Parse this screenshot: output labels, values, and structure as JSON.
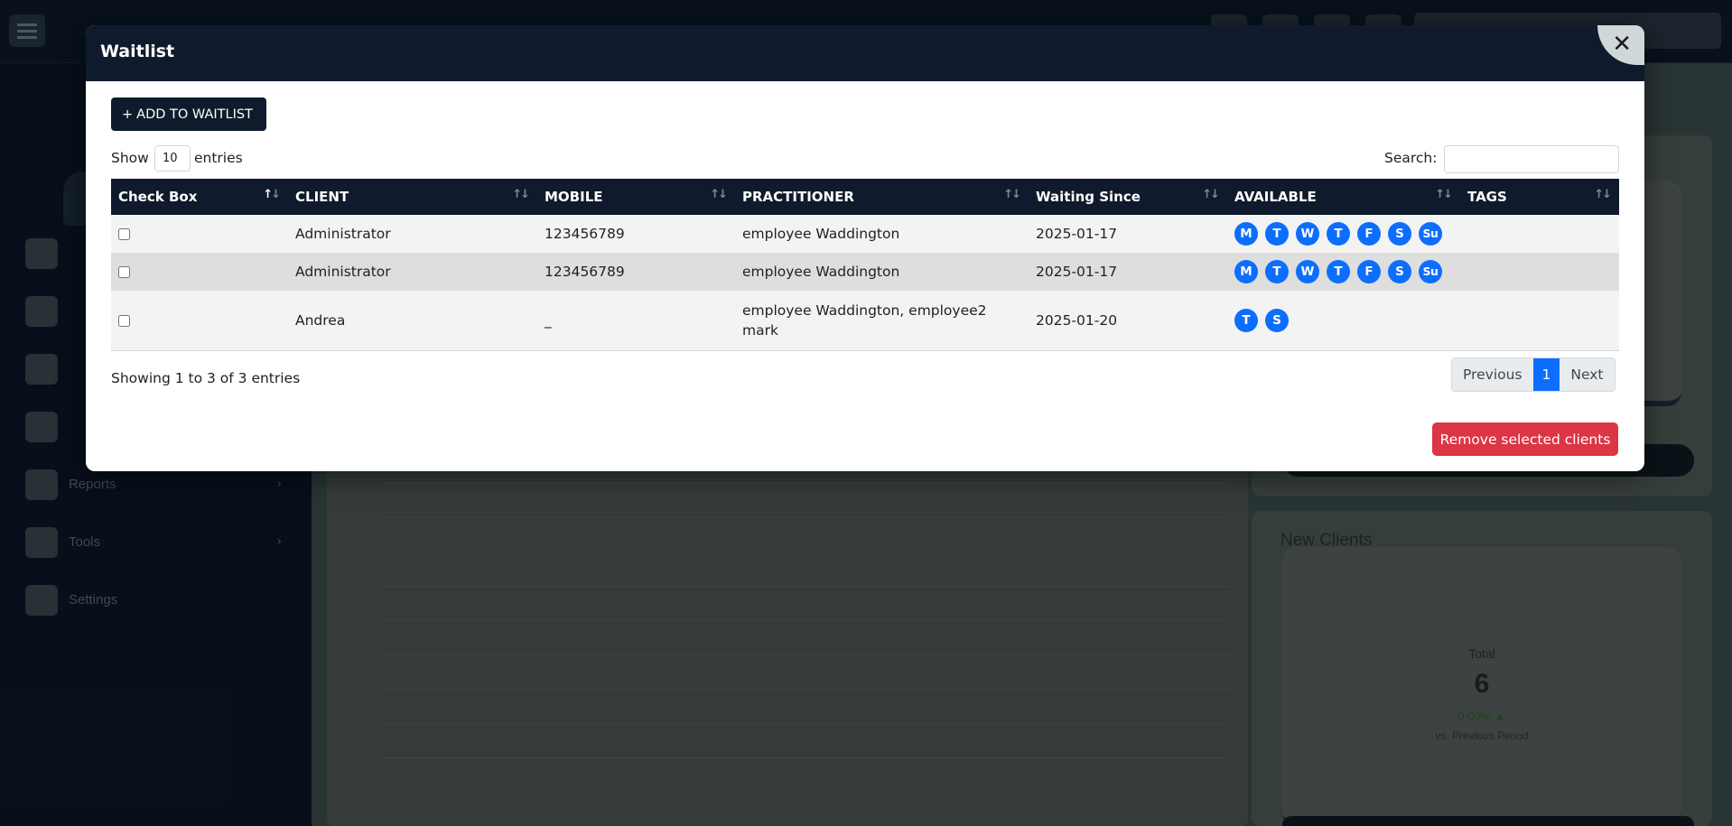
{
  "background": {
    "nav_items": [
      {
        "label": "",
        "icon": "calendar-icon"
      },
      {
        "label": "",
        "icon": "funnel-icon"
      },
      {
        "label": "",
        "icon": "user-icon"
      },
      {
        "label": "",
        "icon": "folder-icon"
      },
      {
        "label": "Reports",
        "icon": "chart-icon"
      },
      {
        "label": "Tools",
        "icon": "wrench-icon"
      },
      {
        "label": "Settings",
        "icon": "gear-icon"
      }
    ],
    "new_clients_card": {
      "title": "New Clients",
      "total_label": "Total",
      "total_value": "6",
      "change": "0.00% ▲",
      "compare_label": "vs. Previous Period"
    }
  },
  "modal": {
    "title": "Waitlist",
    "close_symbol": "✕",
    "add_button": {
      "plus": "+",
      "label": "ADD TO WAITLIST"
    },
    "show_label": "Show",
    "entries_per_page": "10",
    "entries_label": "entries",
    "search_label": "Search:",
    "search_value": "",
    "columns": [
      "Check Box",
      "CLIENT",
      "MOBILE",
      "PRACTITIONER",
      "Waiting Since",
      "AVAILABLE",
      "TAGS"
    ],
    "sort_icon": "↑↓",
    "rows": [
      {
        "client": "Administrator",
        "mobile": "123456789",
        "practitioner": "employee Waddington",
        "waiting_since": "2025-01-17",
        "available": [
          "M",
          "T",
          "W",
          "T",
          "F",
          "S",
          "Su"
        ],
        "tags": ""
      },
      {
        "client": "Administrator",
        "mobile": "123456789",
        "practitioner": "employee Waddington",
        "waiting_since": "2025-01-17",
        "available": [
          "M",
          "T",
          "W",
          "T",
          "F",
          "S",
          "Su"
        ],
        "tags": ""
      },
      {
        "client": "Andrea",
        "mobile": "_",
        "practitioner": "employee Waddington, employee2 mark",
        "waiting_since": "2025-01-20",
        "available": [
          "T",
          "S"
        ],
        "tags": ""
      }
    ],
    "info": "Showing 1 to 3 of 3 entries",
    "pagination": {
      "previous": "Previous",
      "current": "1",
      "next": "Next"
    },
    "remove_button": "Remove selected clients"
  },
  "colors": {
    "header_navy": "#0f1b2c",
    "day_badge_blue": "#0d6efd",
    "remove_red": "#dc3545"
  }
}
